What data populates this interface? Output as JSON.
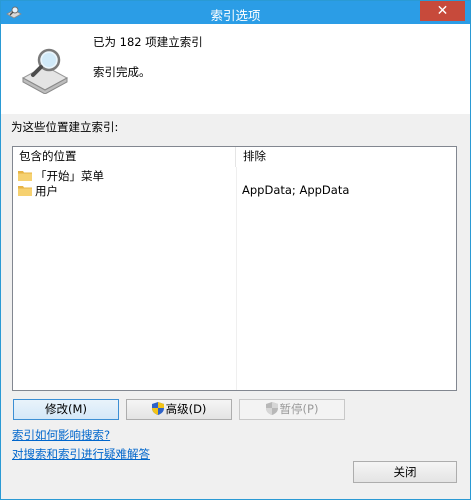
{
  "window": {
    "title": "索引选项",
    "close_glyph": "✕"
  },
  "status": {
    "indexed_count": "已为 182 项建立索引",
    "state": "索引完成。"
  },
  "locations": {
    "section_label": "为这些位置建立索引:",
    "columns": {
      "included": "包含的位置",
      "excluded": "排除"
    },
    "rows": [
      {
        "included": "「开始」菜单",
        "excluded": ""
      },
      {
        "included": "用户",
        "excluded": "AppData; AppData"
      }
    ]
  },
  "buttons": {
    "modify": "修改(M)",
    "advanced": "高级(D)",
    "pause": "暂停(P)",
    "close": "关闭"
  },
  "links": {
    "how_affects_search": "索引如何影响搜索?",
    "troubleshoot": "对搜索和索引进行疑难解答"
  },
  "colors": {
    "title_bar": "#2b9de6",
    "close_button": "#c74a3b",
    "link": "#0066cc"
  },
  "icons": {
    "app": "indexing-options-icon",
    "drive": "drive-magnifier-icon",
    "folder": "folder-icon",
    "shield": "uac-shield-icon"
  }
}
